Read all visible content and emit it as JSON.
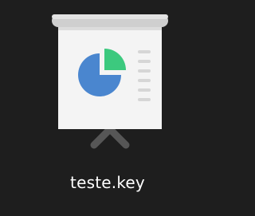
{
  "file": {
    "name": "teste.key",
    "icon": "keynote-presentation-icon",
    "colors": {
      "background": "#1e1e1e",
      "board": "#f4f4f4",
      "rail": "#cfcfcf",
      "pie_blue": "#4a86cf",
      "pie_green": "#3cc97e",
      "lines": "#d6d6d6",
      "stand": "#565656"
    }
  }
}
